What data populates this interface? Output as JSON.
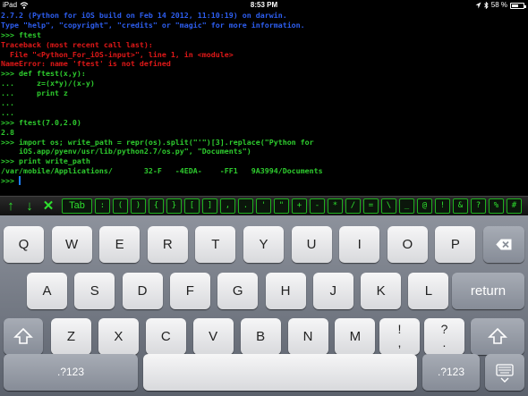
{
  "status_bar": {
    "carrier": "iPad",
    "time": "8:53 PM",
    "battery_text": "58 %",
    "battery_level": 0.58
  },
  "terminal": {
    "lines": [
      {
        "text": "2.7.2 (Python for iOS build on Feb 14 2012, 11:10:19) on darwin.",
        "color": "blue"
      },
      {
        "text": "Type \"help\", \"copyright\", \"credits\" or \"magic\" for more information.",
        "color": "blue"
      },
      {
        "text": ">>> ftest",
        "color": "green"
      },
      {
        "text": "Traceback (most recent call last):",
        "color": "red"
      },
      {
        "text": "  File \"<Python_For_iOS-input>\", line 1, in <module>",
        "color": "red"
      },
      {
        "text": "NameError: name 'ftest' is not defined",
        "color": "red"
      },
      {
        "text": ">>> def ftest(x,y):",
        "color": "green"
      },
      {
        "text": "...     z=(x*y)/(x-y)",
        "color": "green"
      },
      {
        "text": "...     print z",
        "color": "green"
      },
      {
        "text": "...",
        "color": "green"
      },
      {
        "text": "...",
        "color": "green"
      },
      {
        "text": ">>> ftest(7.0,2.0)",
        "color": "green"
      },
      {
        "text": "2.8",
        "color": "green"
      },
      {
        "text": ">>> import os; write_path = repr(os).split(\"'\")[3].replace(\"Python for",
        "color": "green"
      },
      {
        "text": "    iOS.app/pyenv/usr/lib/python2.7/os.py\", \"Documents\")",
        "color": "green"
      },
      {
        "text": ">>> print write_path",
        "color": "green"
      },
      {
        "text": "/var/mobile/Applications/       32-F   -4EDA-    -FF1   9A3994/Documents",
        "color": "green"
      },
      {
        "text": ">>> ",
        "color": "green",
        "cursor": true
      }
    ]
  },
  "accessory_bar": {
    "arrow_up": "↑",
    "arrow_down": "↓",
    "close": "✕",
    "keys": [
      "Tab",
      ":",
      "(",
      ")",
      "{",
      "}",
      "[",
      "]",
      ",",
      ".",
      "'",
      "\"",
      "+",
      "-",
      "*",
      "/",
      "=",
      "\\",
      "_",
      "@",
      "!",
      "&",
      "?",
      "%",
      "#"
    ]
  },
  "keyboard": {
    "row1": [
      "Q",
      "W",
      "E",
      "R",
      "T",
      "Y",
      "U",
      "I",
      "O",
      "P"
    ],
    "row2": [
      "A",
      "S",
      "D",
      "F",
      "G",
      "H",
      "J",
      "K",
      "L"
    ],
    "row3": [
      "Z",
      "X",
      "C",
      "V",
      "B",
      "N",
      "M"
    ],
    "return_label": "return",
    "numbers_label": ".?123",
    "excl_top": "!",
    "excl_bottom": ",",
    "question_top": "?",
    "question_bottom": "."
  },
  "colors": {
    "info_text": "#2d5ef0",
    "error_text": "#e01818",
    "input_text": "#2ecc2e",
    "cursor": "#1e7ef5"
  },
  "icons": {
    "backspace": "backspace-icon",
    "shift": "shift-icon",
    "hide_keyboard": "hide-keyboard-icon",
    "wifi": "wifi-icon",
    "location": "location-arrow-icon",
    "bluetooth": "bluetooth-icon",
    "battery": "battery-icon"
  }
}
